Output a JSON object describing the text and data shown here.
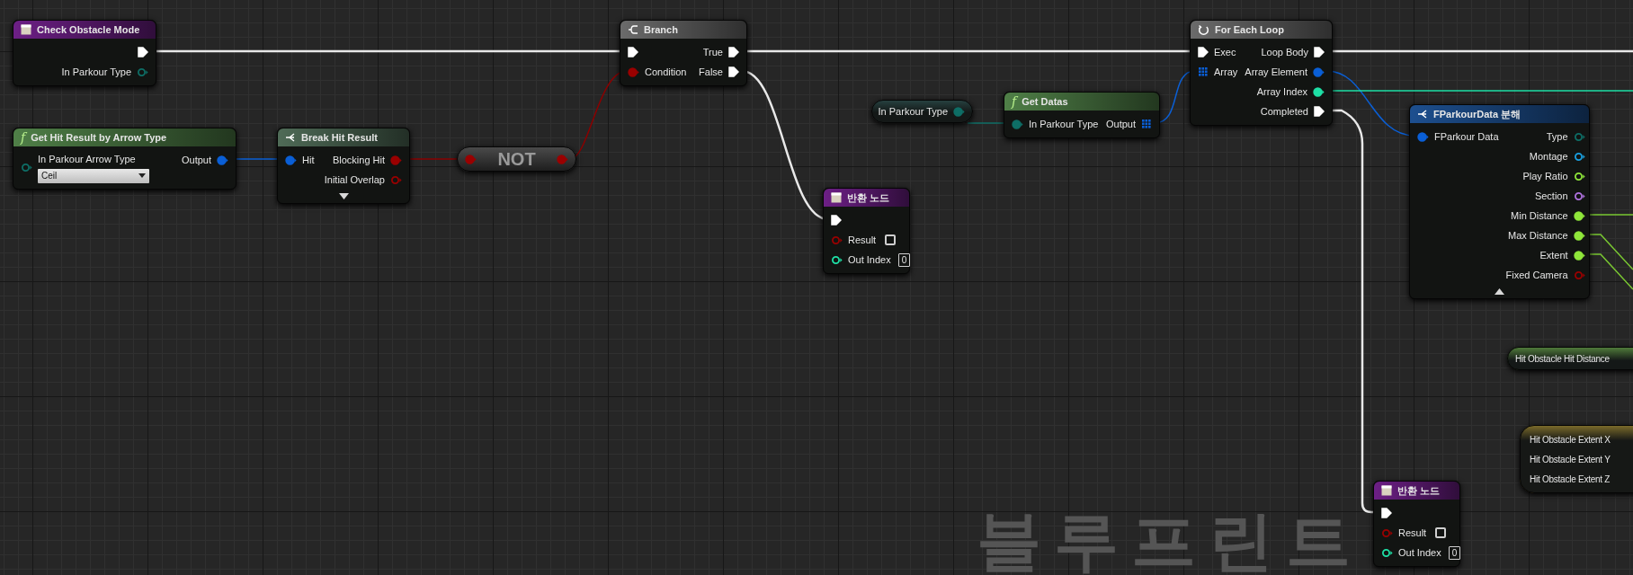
{
  "nodes": [
    {
      "kind": "event",
      "title": "Check Obstacle Mode",
      "color": "#6d1f86",
      "outputs": [
        {
          "kind": "exec",
          "connected": true
        },
        {
          "label": "In Parkour Type",
          "kind": "enum",
          "connected": false
        }
      ]
    },
    {
      "kind": "function",
      "glyph": "f",
      "title": "Get Hit Result by Arrow Type",
      "color": "#4f7f47",
      "inputs": [
        {
          "label": "In Parkour Arrow Type",
          "kind": "enum",
          "connected": false,
          "dropdown": "Ceil"
        }
      ],
      "outputs": [
        {
          "label": "Output",
          "kind": "struct",
          "connected": true
        }
      ]
    },
    {
      "kind": "break",
      "title": "Break Hit Result",
      "color": "#4f6b57",
      "expanded": false,
      "inputs": [
        {
          "label": "Hit",
          "kind": "struct",
          "connected": true
        }
      ],
      "outputs": [
        {
          "label": "Blocking Hit",
          "kind": "bool",
          "connected": true
        },
        {
          "label": "Initial Overlap",
          "kind": "bool",
          "connected": false
        }
      ]
    },
    {
      "kind": "compact",
      "title": "NOT",
      "inputs": [
        {
          "kind": "bool",
          "connected": true
        }
      ],
      "outputs": [
        {
          "kind": "bool",
          "connected": true
        }
      ]
    },
    {
      "kind": "branch",
      "title": "Branch",
      "color": "#6b6b6b",
      "inputs": [
        {
          "kind": "exec",
          "connected": true
        },
        {
          "label": "Condition",
          "kind": "bool",
          "connected": true
        }
      ],
      "outputs": [
        {
          "label": "True",
          "kind": "exec",
          "connected": true
        },
        {
          "label": "False",
          "kind": "exec",
          "connected": true
        }
      ]
    },
    {
      "kind": "return",
      "title": "반환 노드",
      "color": "#6d1f86",
      "inputs": [
        {
          "kind": "exec",
          "connected": true
        },
        {
          "label": "Result",
          "kind": "bool",
          "connected": false,
          "checked": false
        },
        {
          "label": "Out Index",
          "kind": "int",
          "connected": false,
          "value": "0"
        }
      ]
    },
    {
      "kind": "getter",
      "title": "In Parkour Type",
      "outputs": [
        {
          "kind": "enum",
          "connected": true
        }
      ]
    },
    {
      "kind": "function",
      "glyph": "f",
      "title": "Get Datas",
      "color": "#4f7f47",
      "inputs": [
        {
          "label": "In Parkour Type",
          "kind": "enum",
          "connected": true
        }
      ],
      "outputs": [
        {
          "label": "Output",
          "kind": "array",
          "connected": true
        }
      ]
    },
    {
      "kind": "loop",
      "title": "For Each Loop",
      "color": "#6b6b6b",
      "inputs": [
        {
          "label": "Exec",
          "kind": "exec",
          "connected": true
        },
        {
          "label": "Array",
          "kind": "array",
          "connected": true
        }
      ],
      "outputs": [
        {
          "label": "Loop Body",
          "kind": "exec",
          "connected": true
        },
        {
          "label": "Array Element",
          "kind": "struct",
          "connected": true
        },
        {
          "label": "Array Index",
          "kind": "int",
          "connected": true
        },
        {
          "label": "Completed",
          "kind": "exec",
          "connected": true
        }
      ]
    },
    {
      "kind": "break",
      "title": "FParkourData 분해",
      "color": "#1d4f8f",
      "expanded": true,
      "inputs": [
        {
          "label": "FParkour Data",
          "kind": "struct",
          "connected": true
        }
      ],
      "outputs": [
        {
          "label": "Type",
          "kind": "enum",
          "connected": false
        },
        {
          "label": "Montage",
          "kind": "object",
          "connected": false
        },
        {
          "label": "Play Ratio",
          "kind": "float",
          "connected": false
        },
        {
          "label": "Section",
          "kind": "name",
          "connected": false
        },
        {
          "label": "Min Distance",
          "kind": "float",
          "connected": true
        },
        {
          "label": "Max Distance",
          "kind": "float",
          "connected": true
        },
        {
          "label": "Extent",
          "kind": "float",
          "connected": true
        },
        {
          "label": "Fixed Camera",
          "kind": "bool",
          "connected": false
        }
      ]
    },
    {
      "kind": "variable",
      "title": "Hit Obstacle Hit Distance",
      "color": "#4f7a3a"
    },
    {
      "kind": "split",
      "color": "#7a6a2a",
      "outputs": [
        {
          "label": "Hit Obstacle Extent X"
        },
        {
          "label": "Hit Obstacle Extent Y"
        },
        {
          "label": "Hit Obstacle Extent Z"
        }
      ]
    },
    {
      "kind": "return",
      "title": "반환 노드",
      "color": "#6d1f86",
      "inputs": [
        {
          "kind": "exec",
          "connected": true
        },
        {
          "label": "Result",
          "kind": "bool",
          "connected": false,
          "checked": false
        },
        {
          "label": "Out Index",
          "kind": "int",
          "connected": false,
          "value": "0"
        }
      ]
    }
  ],
  "corner_label": "블루프린트"
}
